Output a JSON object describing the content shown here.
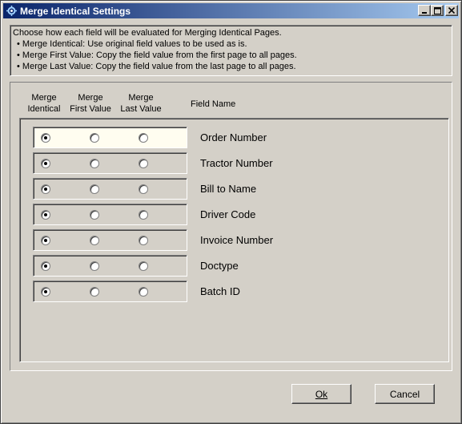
{
  "window": {
    "title": "Merge Identical Settings",
    "icon": "gear-icon",
    "controls": [
      "minimize-icon",
      "maximize-icon",
      "close-icon"
    ]
  },
  "info": {
    "lines": [
      "Choose how each field will be evaluated for Merging Identical Pages.",
      "• Merge Identical:  Use original field values to be used as is.",
      "• Merge First Value:  Copy the field value from the first page to all pages.",
      "• Merge Last Value:  Copy the field value from the last page to all pages."
    ]
  },
  "columns": {
    "merge_identical": "Merge\nIdentical",
    "merge_first": "Merge\nFirst Value",
    "merge_last": "Merge\nLast Value",
    "field_name": "Field Name"
  },
  "fields": [
    {
      "name": "Order Number",
      "selected": "identical"
    },
    {
      "name": "Tractor Number",
      "selected": "identical"
    },
    {
      "name": "Bill to Name",
      "selected": "identical"
    },
    {
      "name": "Driver Code",
      "selected": "identical"
    },
    {
      "name": "Invoice Number",
      "selected": "identical"
    },
    {
      "name": "Doctype",
      "selected": "identical"
    },
    {
      "name": "Batch ID",
      "selected": "identical"
    }
  ],
  "buttons": {
    "ok_label": "Ok",
    "cancel_label": "Cancel"
  }
}
